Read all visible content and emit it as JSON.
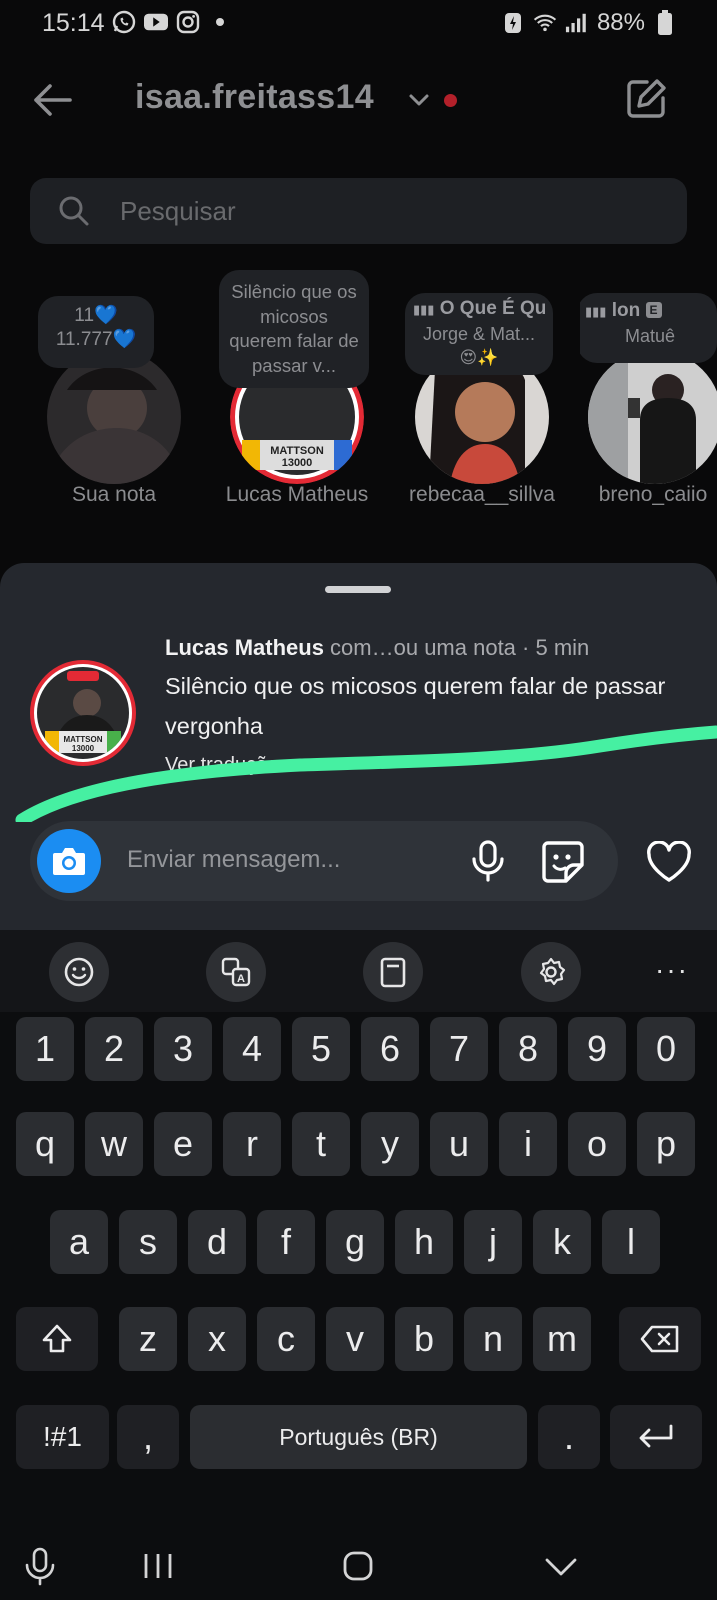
{
  "status_bar": {
    "time": "15:14",
    "battery": "88%",
    "left_icons": [
      "whatsapp-icon",
      "youtube-icon",
      "instagram-icon",
      "dot-icon"
    ],
    "right_icons": [
      "battery-saver-icon",
      "wifi-icon",
      "signal-icon",
      "battery-icon"
    ]
  },
  "header": {
    "username": "isaa.freitass14",
    "back_icon": "arrow-left-icon",
    "compose_icon": "edit-icon"
  },
  "search": {
    "placeholder": "Pesquisar"
  },
  "notes": [
    {
      "name": "Sua nota",
      "text": "11💙\n11.777💙"
    },
    {
      "name": "Lucas Matheus",
      "text": "Silêncio que os micosos querem falar de passar v..."
    },
    {
      "name": "rebecaa__sillva",
      "music_title": "O Que É Qu",
      "music_artist": "Jorge & Mat...",
      "emoji": "😍✨"
    },
    {
      "name": "breno_caiio",
      "music_title": "lon",
      "explicit": "E",
      "music_artist": "Matuê"
    }
  ],
  "sheet": {
    "author": "Lucas Matheus",
    "meta": " com…ou uma nota · 5 min",
    "message": "Silêncio que os micosos querem falar de passar vergonha",
    "translate": "Ver tradução",
    "reply_placeholder": "Enviar mensagem..."
  },
  "colors": {
    "sheet_bg": "#25282e",
    "camera_blue": "#1b8df2",
    "highlight_green": "#46f0a2",
    "story_ring_red": "#e32a35"
  },
  "keyboard": {
    "toolbar_icons": [
      "emoji-icon",
      "translate-icon",
      "clipboard-icon",
      "settings-icon",
      "more-icon"
    ],
    "more_label": "···",
    "row_numbers": [
      "1",
      "2",
      "3",
      "4",
      "5",
      "6",
      "7",
      "8",
      "9",
      "0"
    ],
    "row_top": [
      "q",
      "w",
      "e",
      "r",
      "t",
      "y",
      "u",
      "i",
      "o",
      "p"
    ],
    "row_mid": [
      "a",
      "s",
      "d",
      "f",
      "g",
      "h",
      "j",
      "k",
      "l"
    ],
    "row_bottom": [
      "z",
      "x",
      "c",
      "v",
      "b",
      "n",
      "m"
    ],
    "symbols": "!#1",
    "comma": ",",
    "space": "Português (BR)",
    "period": "."
  }
}
